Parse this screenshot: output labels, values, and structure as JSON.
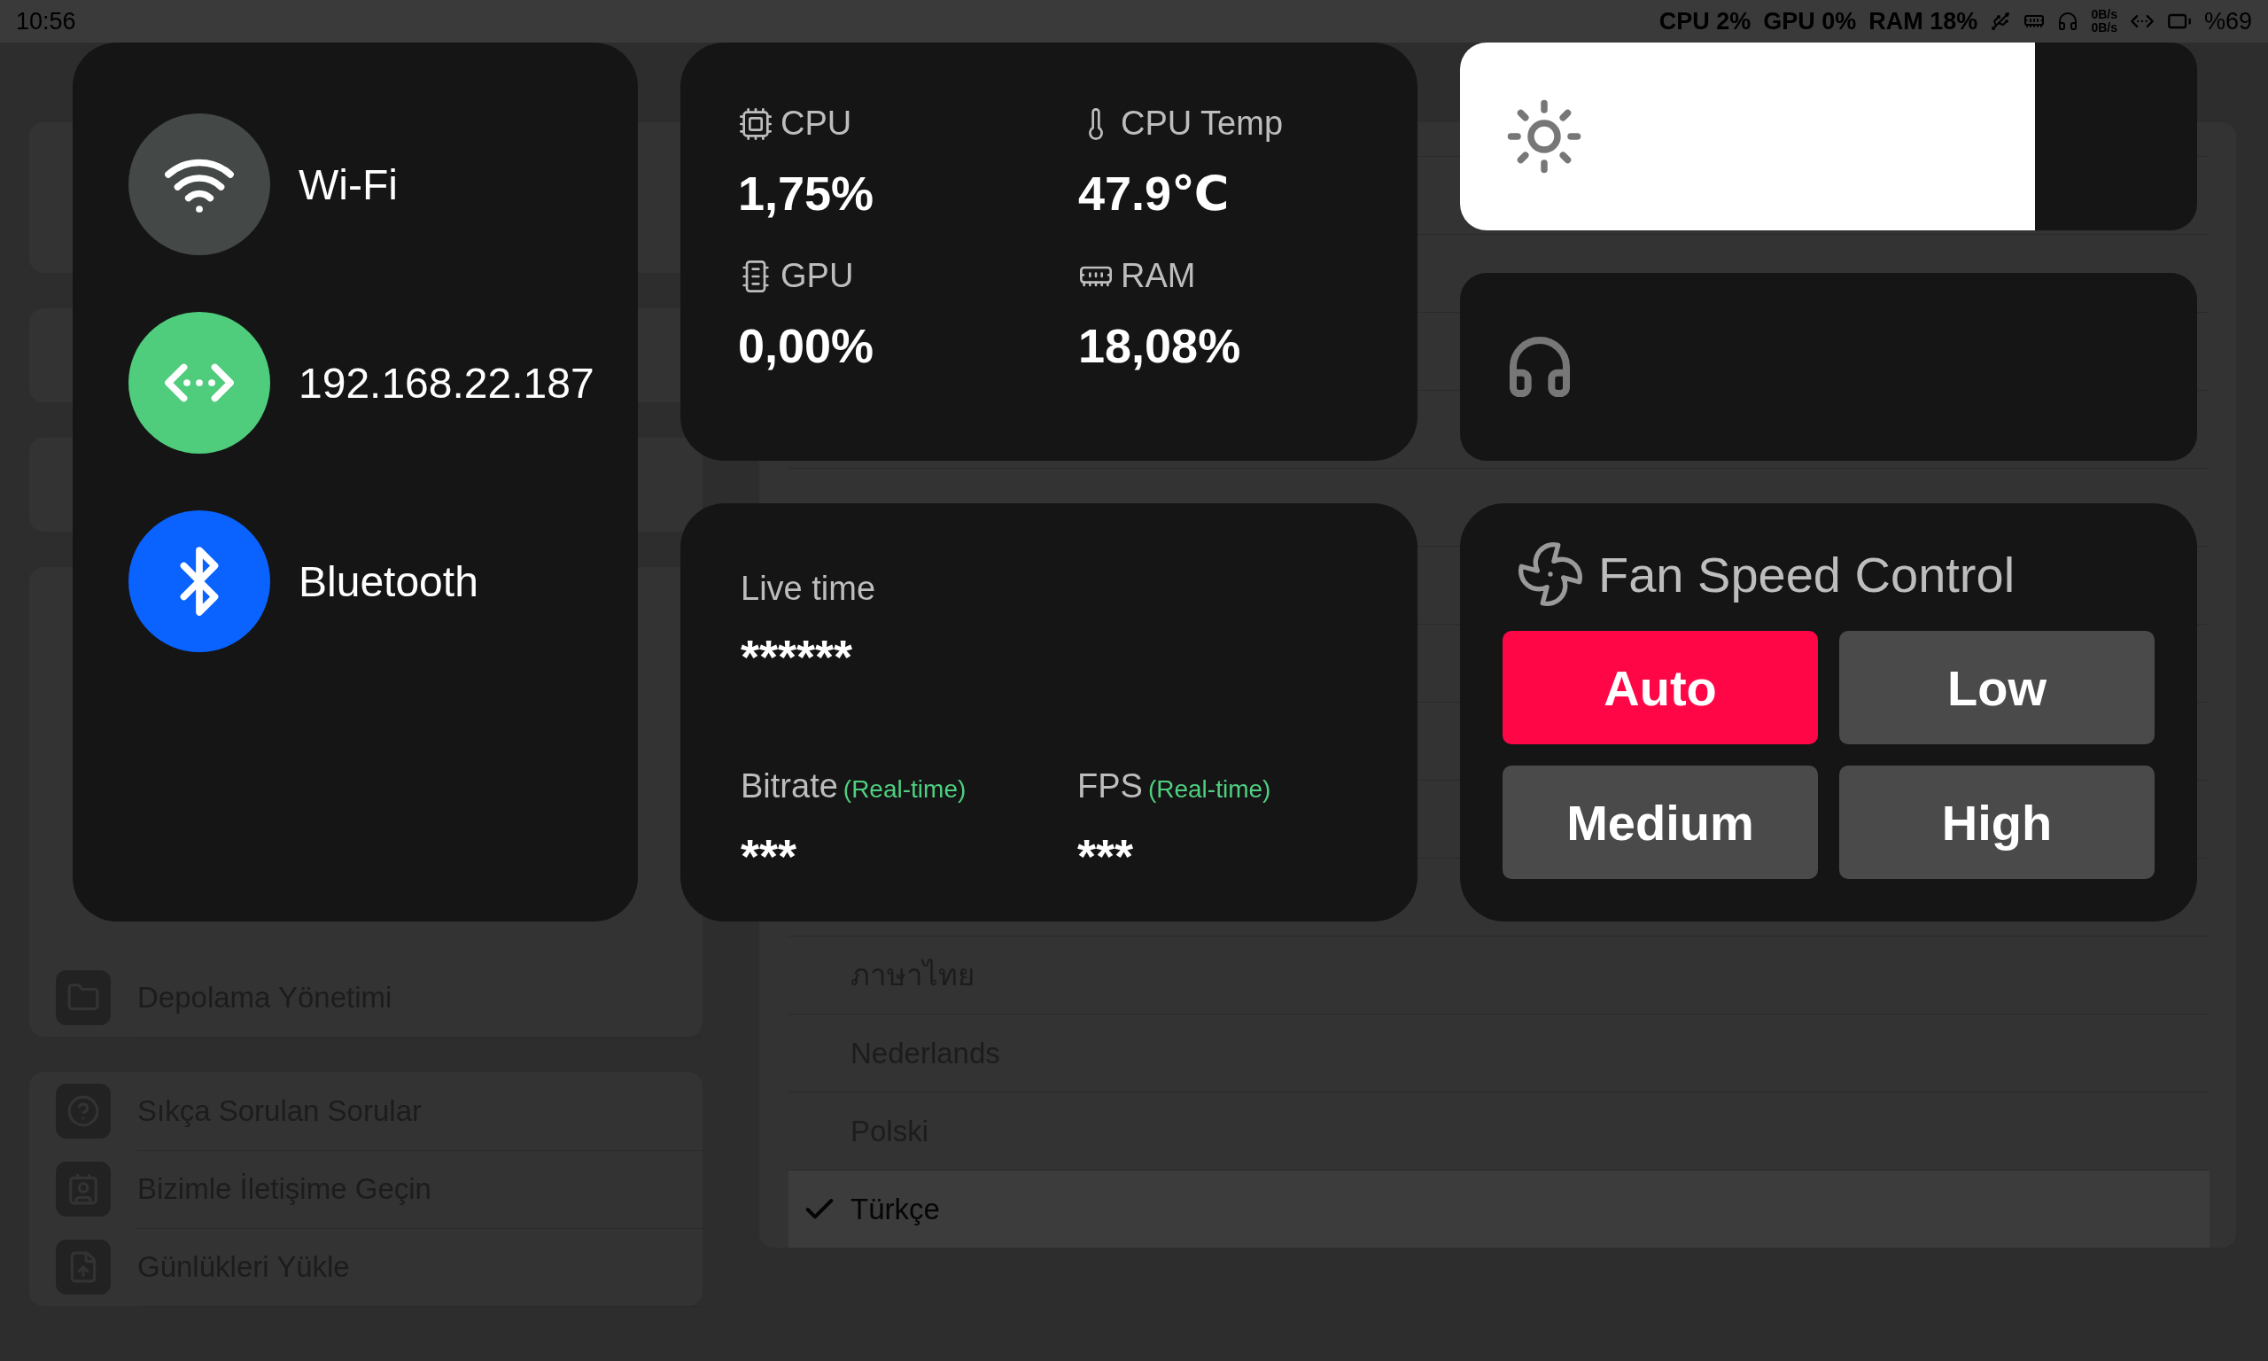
{
  "status_bar": {
    "time": "10:56",
    "indicators": [
      "CPU 2%",
      "GPU 0%",
      "RAM 18%"
    ],
    "net_speed_up": "0B/s",
    "net_speed_down": "0B/s",
    "battery": "%69"
  },
  "background": {
    "settings_items": [
      {
        "kind": "folder",
        "label": "Depolama Yönetimi"
      }
    ],
    "help_items": [
      {
        "kind": "help",
        "label": "Sıkça Sorulan Sorular"
      },
      {
        "kind": "contact",
        "label": "Bizimle İletişime Geçin"
      },
      {
        "kind": "upload",
        "label": "Günlükleri Yükle"
      }
    ],
    "languages": [
      {
        "label": "ภาษาไทย",
        "selected": false
      },
      {
        "label": "Nederlands",
        "selected": false
      },
      {
        "label": "Polski",
        "selected": false
      },
      {
        "label": "Türkçe",
        "selected": true
      }
    ]
  },
  "network_panel": {
    "items": [
      {
        "kind": "wifi",
        "label": "Wi-Fi",
        "on": false
      },
      {
        "kind": "ip",
        "label": "192.168.22.187",
        "on": true
      },
      {
        "kind": "bluetooth",
        "label": "Bluetooth",
        "on": true
      }
    ]
  },
  "stats": [
    {
      "kind": "cpu",
      "label": "CPU",
      "value": "1,75%"
    },
    {
      "kind": "temp",
      "label": "CPU Temp",
      "value": "47.9℃"
    },
    {
      "kind": "gpu",
      "label": "GPU",
      "value": "0,00%"
    },
    {
      "kind": "ram",
      "label": "RAM",
      "value": "18,08%"
    }
  ],
  "brightness": {
    "level": 0.78
  },
  "live": {
    "live_time": {
      "label": "Live time",
      "value": "******"
    },
    "metrics": [
      {
        "label": "Bitrate",
        "note": "(Real-time)",
        "value": "***"
      },
      {
        "label": "FPS",
        "note": "(Real-time)",
        "value": "***"
      }
    ]
  },
  "fan": {
    "title": "Fan Speed Control",
    "modes": [
      {
        "label": "Auto",
        "selected": true
      },
      {
        "label": "Low",
        "selected": false
      },
      {
        "label": "Medium",
        "selected": false
      },
      {
        "label": "High",
        "selected": false
      }
    ]
  }
}
